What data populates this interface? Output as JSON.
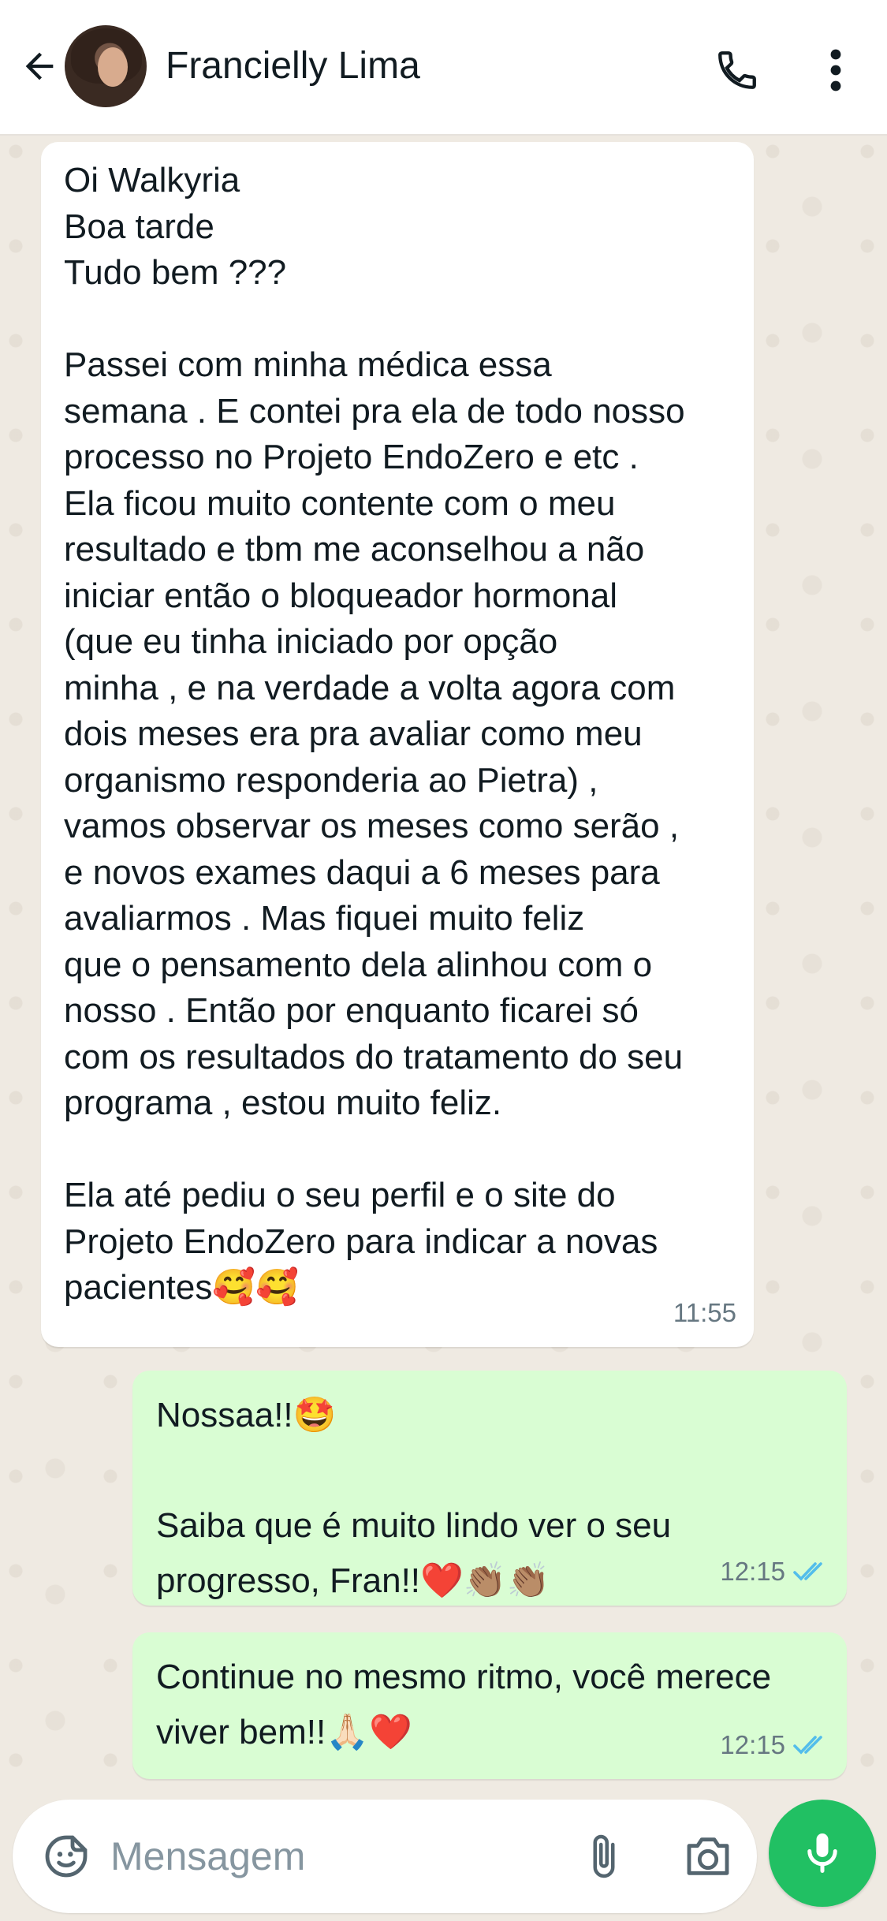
{
  "header": {
    "contact_name": "Francielly Lima",
    "icons": [
      "arrow-left-icon",
      "avatar",
      "phone-icon",
      "more-vertical-icon"
    ]
  },
  "messages": [
    {
      "direction": "incoming",
      "text": "Oi Walkyria\nBoa tarde\nTudo bem ???\n\nPassei com minha médica essa\nsemana . E contei pra ela de todo nosso\nprocesso no Projeto EndoZero e etc .\nEla ficou muito contente com o meu\nresultado e tbm me aconselhou a não\niniciar então o bloqueador hormonal\n(que eu tinha iniciado por opção\nminha , e na verdade a volta agora com\ndois meses era pra avaliar como meu\norganismo responderia ao Pietra) ,\nvamos observar os meses como serão ,\ne novos exames daqui a 6 meses para\navaliarmos . Mas fiquei muito feliz\nque o pensamento dela alinhou com o\nnosso . Então por enquanto ficarei só\ncom os resultados do tratamento do seu\nprograma , estou muito feliz.\n\nEla até pediu o seu perfil e o site do\nProjeto EndoZero para indicar a novas\npacientes🥰🥰",
      "time": "11:55"
    },
    {
      "direction": "outgoing",
      "text": "Nossaa!!🤩\n\nSaiba que é muito lindo ver o seu\nprogresso, Fran!!❤️👏🏽👏🏽",
      "time": "12:15",
      "status": "read"
    },
    {
      "direction": "outgoing",
      "text": "Continue no mesmo ritmo, você merece\nviver bem!!🙏🏻❤️",
      "time": "12:15",
      "status": "read"
    }
  ],
  "composer": {
    "placeholder": "Mensagem"
  },
  "colors": {
    "incoming_bubble": "#ffffff",
    "outgoing_bubble": "#d9fdd3",
    "chat_background": "#efeae2",
    "mic_button": "#21c063",
    "read_ticks": "#53bdeb"
  }
}
